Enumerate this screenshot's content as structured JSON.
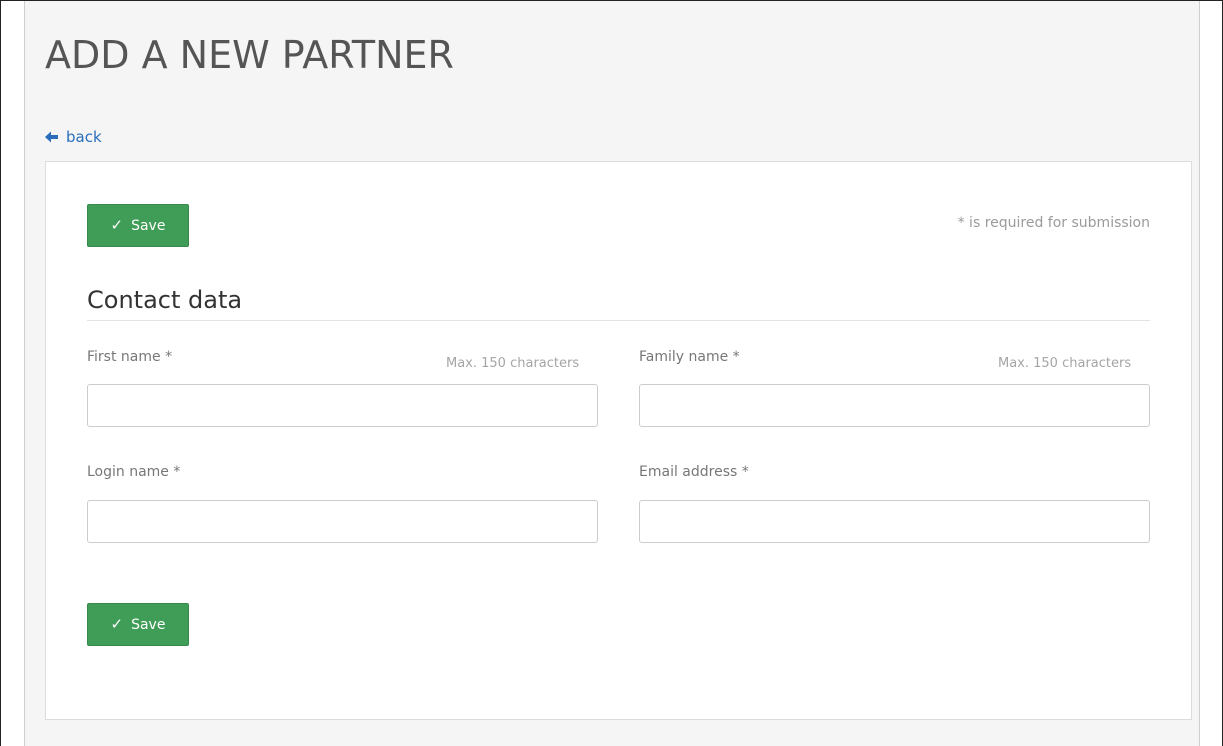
{
  "page": {
    "title": "ADD A NEW PARTNER",
    "back_label": "back"
  },
  "form": {
    "save_label": "Save",
    "required_note": "* is required for submission",
    "section_title": "Contact data",
    "fields": {
      "first_name": {
        "label": "First name *",
        "hint": "Max. 150 characters",
        "value": "",
        "placeholder": ""
      },
      "family_name": {
        "label": "Family name *",
        "hint": "Max. 150 characters",
        "value": "",
        "placeholder": ""
      },
      "login_name": {
        "label": "Login name *",
        "value": "",
        "placeholder": ""
      },
      "email": {
        "label": "Email address *",
        "value": "",
        "placeholder": ""
      }
    }
  },
  "icons": {
    "back": "arrow-left-icon",
    "save": "checkmark-icon"
  },
  "colors": {
    "accent_link": "#2a6ebb",
    "save_button": "#3f9d57",
    "background": "#f5f5f5"
  }
}
